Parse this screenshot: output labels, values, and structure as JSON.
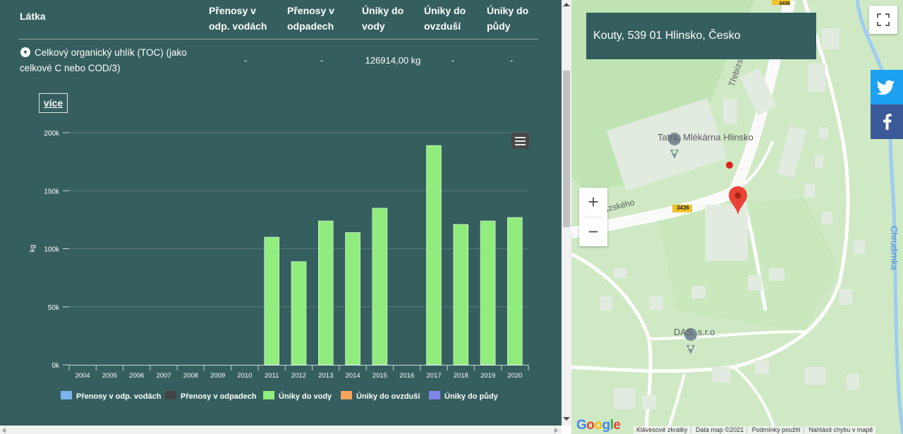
{
  "table": {
    "headers": {
      "substance": "Látka",
      "transfers_water": "Přenosy v odp. vodách",
      "transfers_waste": "Přenosy v odpadech",
      "release_water": "Úniky do vody",
      "release_air": "Úniky do ovzduší",
      "release_soil": "Úniky do půdy"
    },
    "row": {
      "toggle_icon": "chevron-down-circle-icon",
      "name": "Celkový organický uhlík (TOC) (jako celkové C nebo COD/3)",
      "transfers_water": "-",
      "transfers_waste": "-",
      "release_water": "126914,00 kg",
      "release_air": "-",
      "release_soil": "-"
    }
  },
  "more_button": "více",
  "chart_data": {
    "type": "bar",
    "title": "",
    "xlabel": "",
    "ylabel": "kg",
    "ylim": [
      0,
      200000
    ],
    "y_ticks": [
      "0k",
      "50k",
      "100k",
      "150k",
      "200k"
    ],
    "categories": [
      "2004",
      "2005",
      "2006",
      "2007",
      "2008",
      "2009",
      "2010",
      "2011",
      "2012",
      "2013",
      "2014",
      "2015",
      "2016",
      "2017",
      "2018",
      "2019",
      "2020"
    ],
    "series": [
      {
        "name": "Přenosy v odp. vodách",
        "color": "#7cb5ec",
        "values": [
          null,
          null,
          null,
          null,
          null,
          null,
          null,
          null,
          null,
          null,
          null,
          null,
          null,
          null,
          null,
          null,
          null
        ]
      },
      {
        "name": "Přenosy v odpadech",
        "color": "#434348",
        "values": [
          null,
          null,
          null,
          null,
          null,
          null,
          null,
          null,
          null,
          null,
          null,
          null,
          null,
          null,
          null,
          null,
          null
        ]
      },
      {
        "name": "Úniky do vody",
        "color": "#90ed7d",
        "values": [
          null,
          null,
          null,
          null,
          null,
          null,
          null,
          110000,
          89000,
          124000,
          114000,
          135000,
          null,
          189000,
          121000,
          124000,
          127000
        ]
      },
      {
        "name": "Úniky do ovzduší",
        "color": "#f7a35c",
        "values": [
          null,
          null,
          null,
          null,
          null,
          null,
          null,
          null,
          null,
          null,
          null,
          null,
          null,
          null,
          null,
          null,
          null
        ]
      },
      {
        "name": "Úniky do půdy",
        "color": "#8085e9",
        "values": [
          null,
          null,
          null,
          null,
          null,
          null,
          null,
          null,
          null,
          null,
          null,
          null,
          null,
          null,
          null,
          null,
          null
        ]
      }
    ],
    "grid": true,
    "legend": "bottom",
    "menu_icon": "hamburger-menu-icon"
  },
  "map": {
    "address": "Kouty, 539 01 Hlinsko, Česko",
    "labels": {
      "poi_1": "Tatra, Mlékárna Hlinsko",
      "poi_2": "DAS, s.r.o",
      "street_1": "Třebízského",
      "street_2": "Třebízského",
      "river": "Chrudimka",
      "road_num": "3436"
    },
    "zoom_in": "+",
    "zoom_out": "−",
    "logo": "Google",
    "attribution": [
      "Klávesové zkratky",
      "Data map ©2021",
      "Podmínky použití",
      "Nahlásit chybu v mapě"
    ],
    "marker_icon": "map-pin-icon",
    "fullscreen_icon": "fullscreen-icon"
  },
  "share": {
    "twitter_icon": "twitter-icon",
    "facebook_icon": "facebook-icon",
    "twitter_color": "#1da1f2",
    "facebook_color": "#3b5998"
  }
}
